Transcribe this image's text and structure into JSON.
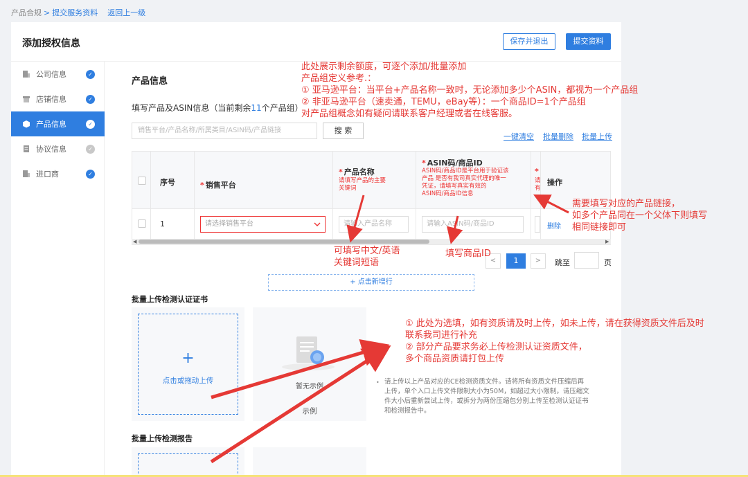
{
  "breadcrumb": {
    "root": "产品合规",
    "sep": ">",
    "current": "提交服务资料",
    "back": "返回上一级"
  },
  "header": {
    "title": "添加授权信息",
    "save_exit": "保存并退出",
    "submit": "提交资料"
  },
  "sidebar": {
    "items": [
      {
        "label": "公司信息",
        "icon": "building-icon",
        "status": "done"
      },
      {
        "label": "店铺信息",
        "icon": "store-icon",
        "status": "done"
      },
      {
        "label": "产品信息",
        "icon": "box-icon",
        "status": "active"
      },
      {
        "label": "协议信息",
        "icon": "document-icon",
        "status": "pending"
      },
      {
        "label": "进口商",
        "icon": "building-icon",
        "status": "done"
      }
    ]
  },
  "product": {
    "section_title": "产品信息",
    "subtitle_pre": "填写产品及ASIN信息（当前剩余",
    "remaining": "11",
    "subtitle_post": "个产品组）",
    "search_placeholder": "销售平台/产品名称/所属类目/ASIN码/产品链接",
    "search_btn": "搜 索",
    "links": {
      "clear": "一键清空",
      "batch_delete": "批量删除",
      "batch_upload": "批量上传"
    }
  },
  "table": {
    "headers": {
      "index": "序号",
      "platform": "销售平台",
      "name": "产品名称",
      "name_note": [
        "请填写产品的主要",
        "关键词"
      ],
      "asin": "ASIN码/商品ID",
      "asin_note": [
        "ASIN码/商品ID是平台用于验证该",
        "产品 是否有我司真实代理的唯一",
        "凭证，请填写真实有效的",
        "ASIN码/商品ID信息"
      ],
      "partial_note": [
        "请",
        "有"
      ],
      "action": "操作"
    },
    "rows": [
      {
        "index": "1",
        "platform_placeholder": "请选择销售平台",
        "name_placeholder": "请输入产品名称",
        "asin_placeholder": "请输入ASIN码/商品ID",
        "action": "删除"
      }
    ]
  },
  "pagination": {
    "prev": "<",
    "current": "1",
    "next": ">",
    "goto": "跳至",
    "page": "页"
  },
  "add_row": "+ 点击新增行",
  "cert": {
    "title": "批量上传检测认证证书",
    "upload_label": "点击或拖动上传",
    "sample_empty": "暂无示例",
    "sample_label": "示例",
    "hint": [
      "请上传以上产品对应的CE检测资质文件。请将所有资质文件压缩后再",
      "上传，单个入口上传文件限制大小为50M，如超过大小限制，请压缩文",
      "件大小后重新尝试上传，或拆分为两份压缩包分别上传至检测认证证书",
      "和检测报告中。"
    ]
  },
  "report": {
    "title": "批量上传检测报告"
  },
  "annotations": {
    "top": [
      "此处展示剩余额度，可逐个添加/批量添加",
      "产品组定义参考.：",
      "① 亚马逊平台：当平台+产品名称一致时，无论添加多少个ASIN，都视为一个产品组",
      "② 非亚马逊平台（速卖通，TEMU，eBay等）：一个商品ID=1个产品组",
      "对产品组概念如有疑问请联系客户经理或者在线客服。"
    ],
    "link": [
      "需要填写对应的产品链接，",
      "如多个产品同在一个父体下则填写",
      "相同链接即可"
    ],
    "name": [
      "可填写中文/英语",
      "关键词短语"
    ],
    "asin": "填写商品ID",
    "upload": [
      "① 此处为选填，如有资质请及时上传，如未上传，请在获得资质文件后及时",
      "联系我司进行补充",
      "② 部分产品要求务必上传检测认证资质文件，",
      "多个商品资质请打包上传"
    ]
  },
  "colors": {
    "primary": "#2f7ee0",
    "annotation": "#e53935"
  }
}
